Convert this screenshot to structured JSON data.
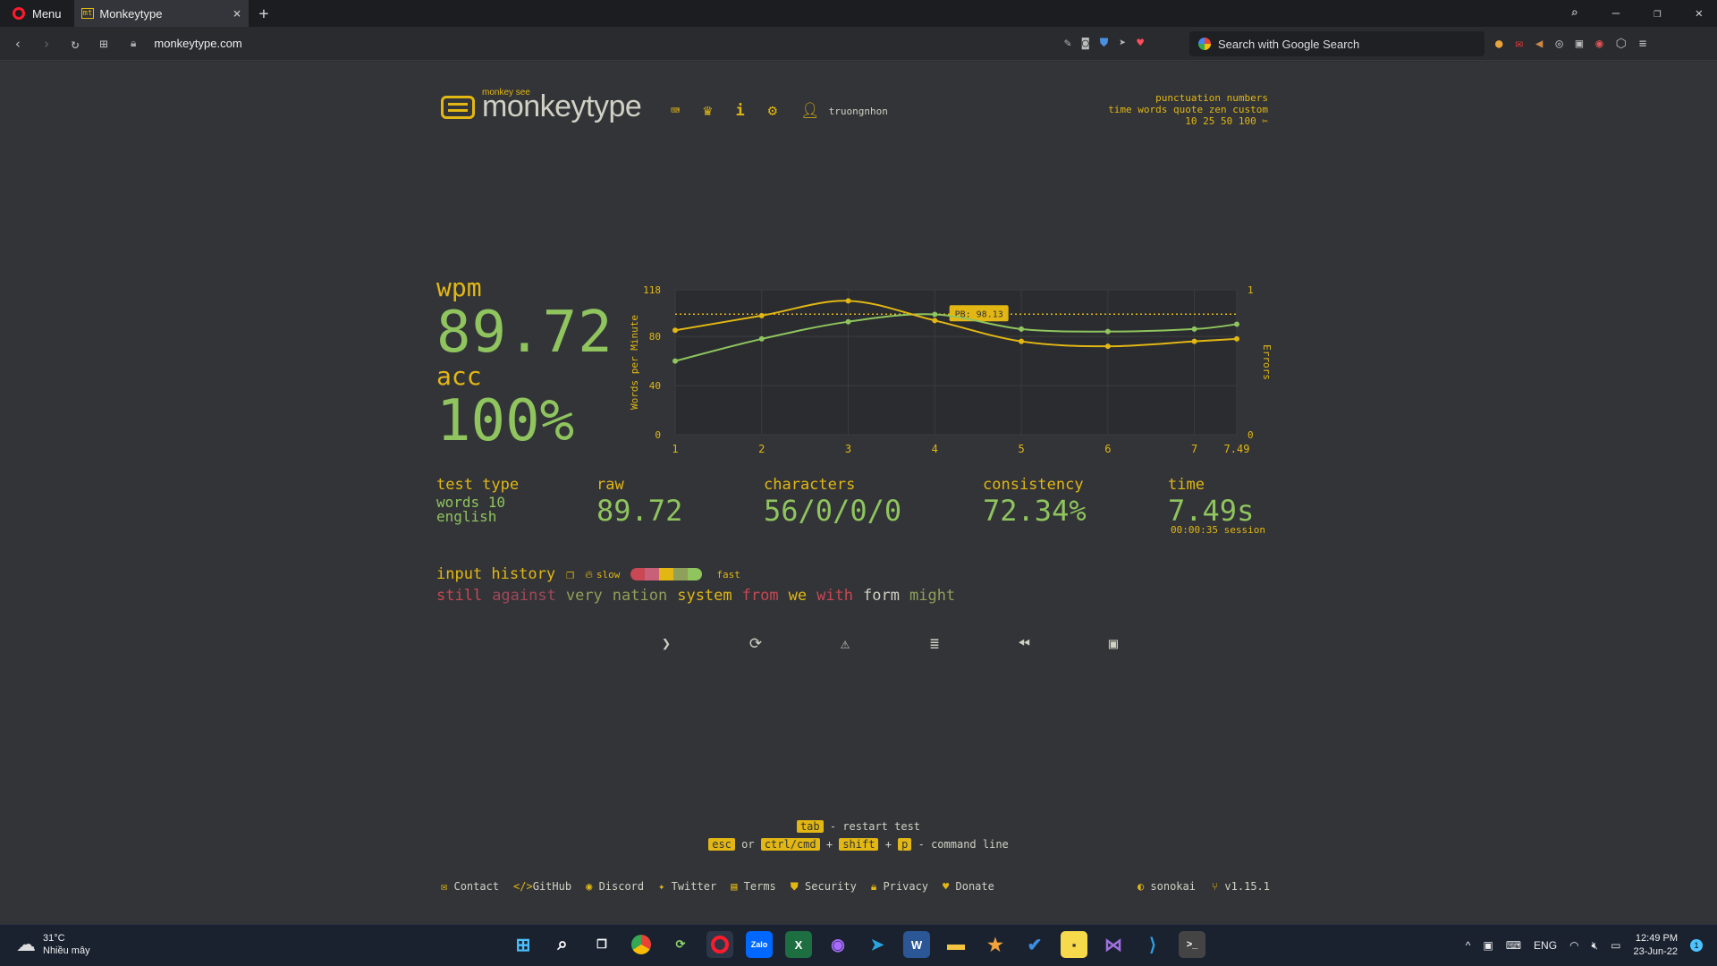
{
  "browser": {
    "menu_label": "Menu",
    "tab_title": "Monkeytype",
    "tab_favicon": "mt",
    "url": "monkeytype.com",
    "search_placeholder": "Search with Google Search"
  },
  "header": {
    "logo_small": "monkey see",
    "logo_text": "monkeytype",
    "username": "truongnhon",
    "config_line1": "punctuation numbers",
    "config_line2": "time words quote zen custom",
    "config_line3": "10 25 50 100 ✂"
  },
  "result": {
    "wpm_label": "wpm",
    "wpm_value": "89.72",
    "acc_label": "acc",
    "acc_value": "100%",
    "test_type_label": "test type",
    "test_type_line1": "words 10",
    "test_type_line2": "english",
    "raw_label": "raw",
    "raw_value": "89.72",
    "characters_label": "characters",
    "characters_value": "56/0/0/0",
    "consistency_label": "consistency",
    "consistency_value": "72.34%",
    "time_label": "time",
    "time_value": "7.49s",
    "session": "00:00:35 session"
  },
  "input_history": {
    "label": "input history",
    "slow": "slow",
    "fast": "fast",
    "words": [
      {
        "text": "still",
        "color": "#ca4754"
      },
      {
        "text": "against",
        "color": "#a0485a"
      },
      {
        "text": "very",
        "color": "#8fa05a"
      },
      {
        "text": "nation",
        "color": "#8fa05a"
      },
      {
        "text": "system",
        "color": "#e2b714"
      },
      {
        "text": "from",
        "color": "#ca4754"
      },
      {
        "text": "we",
        "color": "#e2b714"
      },
      {
        "text": "with",
        "color": "#ca4754"
      },
      {
        "text": "form",
        "color": "#d1d0c5"
      },
      {
        "text": "might",
        "color": "#8fa05a"
      }
    ]
  },
  "hints": {
    "tab_key": "tab",
    "tab_text": "- restart test",
    "esc_key": "esc",
    "or": "or",
    "ctrl_key": "ctrl/cmd",
    "plus": "+",
    "shift_key": "shift",
    "p_key": "p",
    "cmd_text": "- command line"
  },
  "footer": {
    "links": [
      "Contact",
      "GitHub",
      "Discord",
      "Twitter",
      "Terms",
      "Security",
      "Privacy",
      "Donate"
    ],
    "theme": "sonokai",
    "version": "v1.15.1"
  },
  "taskbar": {
    "temp": "31°C",
    "weather_desc": "Nhiều mây",
    "lang": "ENG",
    "time": "12:49 PM",
    "date": "23-Jun-22",
    "notif_count": "1"
  },
  "chart_data": {
    "type": "line",
    "x": [
      1,
      2,
      3,
      4,
      5,
      6,
      7,
      7.49
    ],
    "x_ticks": [
      "1",
      "2",
      "3",
      "4",
      "5",
      "6",
      "7",
      "7.49"
    ],
    "ylabel": "Words per Minute",
    "ylabel_right": "Errors",
    "y_ticks": [
      "0",
      "40",
      "80",
      "118"
    ],
    "y_right_ticks": [
      "0",
      "1"
    ],
    "ylim": [
      0,
      118
    ],
    "series": [
      {
        "values": [
          60,
          78,
          92,
          98,
          86,
          84,
          86,
          90
        ],
        "color": "#8fc45e"
      },
      {
        "values": [
          85,
          97,
          109,
          93,
          76,
          72,
          76,
          78
        ],
        "color": "#e2b714"
      }
    ],
    "pb_value": 98.13,
    "pb_label": "PB: 98.13"
  }
}
